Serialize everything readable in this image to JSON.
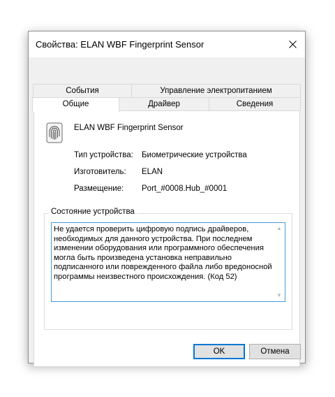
{
  "window": {
    "title": "Свойства: ELAN WBF Fingerprint Sensor"
  },
  "tabs": {
    "row_back": [
      {
        "label": "События"
      },
      {
        "label": "Управление электропитанием"
      }
    ],
    "row_front": [
      {
        "label": "Общие",
        "active": true
      },
      {
        "label": "Драйвер",
        "active": false
      },
      {
        "label": "Сведения",
        "active": false
      }
    ]
  },
  "general": {
    "device_name": "ELAN WBF Fingerprint Sensor",
    "device_icon": "fingerprint-icon",
    "properties": [
      {
        "label": "Тип устройства:",
        "value": "Биометрические устройства"
      },
      {
        "label": "Изготовитель:",
        "value": "ELAN"
      },
      {
        "label": "Размещение:",
        "value": "Port_#0008.Hub_#0001"
      }
    ],
    "status_group": {
      "title": "Состояние устройства",
      "text": "Не удается проверить цифровую подпись драйверов, необходимых для данного устройства. При последнем изменении оборудования или программного обеспечения могла быть произведена установка неправильно подписанного или поврежденного файла либо вредоносной программы неизвестного происхождения. (Код 52)"
    }
  },
  "buttons": {
    "ok": "OK",
    "cancel": "Отмена"
  },
  "colors": {
    "accent": "#0078d7",
    "focus_border": "#4a9ad4",
    "dialog_bg": "#f0f0f0",
    "panel_bg": "#ffffff"
  }
}
